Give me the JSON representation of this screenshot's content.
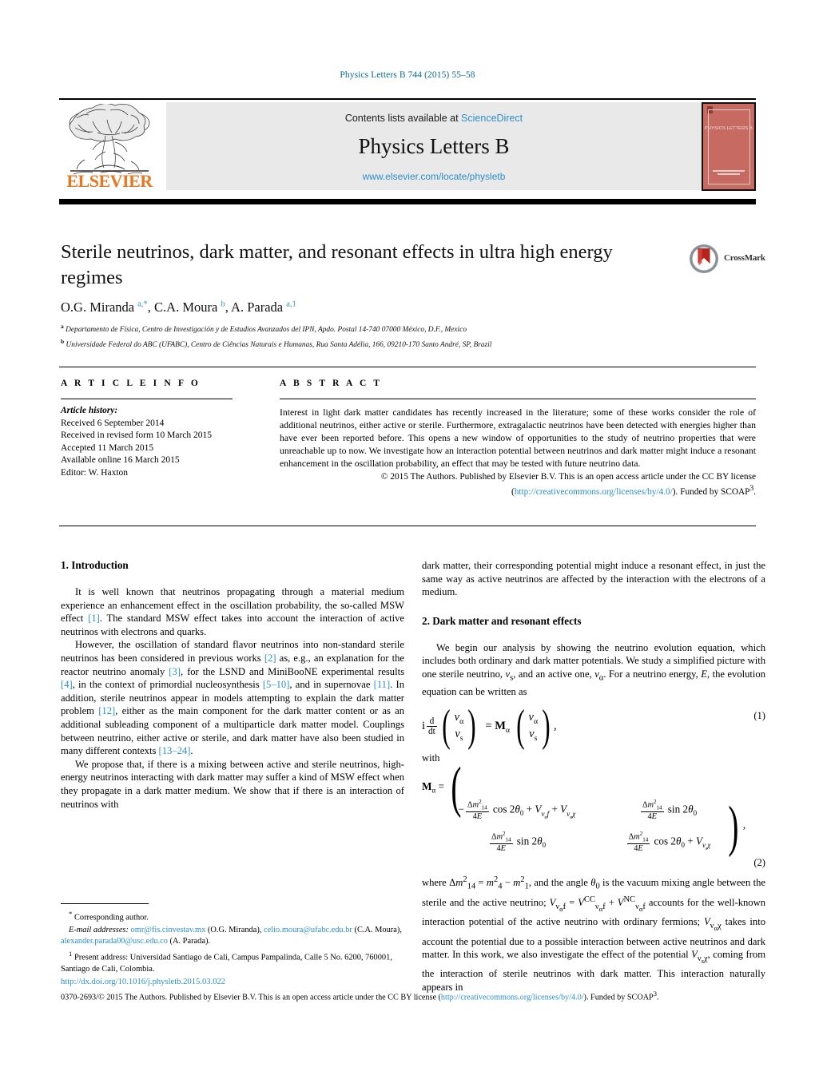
{
  "running_head": "Physics Letters B 744 (2015) 55–58",
  "masthead": {
    "contents_prefix": "Contents lists available at ",
    "sciencedirect": "ScienceDirect",
    "journal_name": "Physics Letters B",
    "journal_url": "www.elsevier.com/locate/physletb",
    "publisher_logo_text": "ELSEVIER",
    "cover_title": "PHYSICS LETTERS B"
  },
  "article": {
    "title": "Sterile neutrinos, dark matter, and resonant effects in ultra high energy regimes",
    "crossmark_label": "CrossMark",
    "authors_html": "O.G. Miranda <sup>a,*</sup>, C.A. Moura <sup>b</sup>, A. Parada <sup>a,1</sup>",
    "affiliation_a": "Departamento de Física, Centro de Investigación y de Estudios Avanzados del IPN, Apdo. Postal 14-740 07000 México, D.F., Mexico",
    "affiliation_b": "Universidade Federal do ABC (UFABC), Centro de Ciências Naturais e Humanas, Rua Santa Adélia, 166, 09210-170 Santo André, SP, Brazil"
  },
  "article_info": {
    "heading": "A R T I C L E   I N F O",
    "history_label": "Article history:",
    "received": "Received 6 September 2014",
    "revised": "Received in revised form 10 March 2015",
    "accepted": "Accepted 11 March 2015",
    "online": "Available online 16 March 2015",
    "editor": "Editor: W. Haxton"
  },
  "abstract": {
    "heading": "A B S T R A C T",
    "text": "Interest in light dark matter candidates has recently increased in the literature; some of these works consider the role of additional neutrinos, either active or sterile. Furthermore, extragalactic neutrinos have been detected with energies higher than have ever been reported before. This opens a new window of opportunities to the study of neutrino properties that were unreachable up to now. We investigate how an interaction potential between neutrinos and dark matter might induce a resonant enhancement in the oscillation probability, an effect that may be tested with future neutrino data.",
    "copyright_lead": "© 2015 The Authors. Published by Elsevier B.V. This is an open access article under the CC BY license",
    "license_open_paren": "(",
    "license_url": "http://creativecommons.org/licenses/by/4.0/",
    "copyright_tail": "). Funded by SCOAP",
    "scoap_sup": "3",
    "copyright_period": "."
  },
  "left_column": {
    "section_heading": "1. Introduction",
    "p1_a": "It is well known that neutrinos propagating through a material medium experience an enhancement effect in the oscillation probability, the so-called MSW effect ",
    "p1_ref1": "[1]",
    "p1_b": ". The standard MSW effect takes into account the interaction of active neutrinos with electrons and quarks.",
    "p2_a": "However, the oscillation of standard flavor neutrinos into non-standard sterile neutrinos has been considered in previous works ",
    "p2_ref2": "[2]",
    "p2_b": " as, e.g., an explanation for the reactor neutrino anomaly ",
    "p2_ref3": "[3]",
    "p2_c": ", for the LSND and MiniBooNE experimental results ",
    "p2_ref4": "[4]",
    "p2_d": ", in the context of primordial nucleosynthesis ",
    "p2_ref5": "[5–10]",
    "p2_e": ", and in supernovae ",
    "p2_ref11": "[11]",
    "p2_f": ". In addition, sterile neutrinos appear in models attempting to explain the dark matter problem ",
    "p2_ref12": "[12]",
    "p2_g": ", either as the main component for the dark matter content or as an additional subleading component of a multiparticle dark matter model. Couplings between neutrino, either active or sterile, and dark matter have also been studied in many different contexts ",
    "p2_ref13": "[13–24]",
    "p2_h": ".",
    "p3": "We propose that, if there is a mixing between active and sterile neutrinos, high-energy neutrinos interacting with dark matter may suffer a kind of MSW effect when they propagate in a dark matter medium. We show that if there is an interaction of neutrinos with"
  },
  "right_column": {
    "p1": "dark matter, their corresponding potential might induce a resonant effect, in just the same way as active neutrinos are affected by the interaction with the electrons of a medium.",
    "section_heading": "2. Dark matter and resonant effects",
    "p2_html": "We begin our analysis by showing the neutrino evolution equation, which includes both ordinary and dark matter potentials. We study a simplified picture with one sterile neutrino, <i>ν</i><sub>s</sub>, and an active one, <i>ν</i><sub>α</sub>. For a neutrino energy, <i>E</i>, the evolution equation can be written as",
    "eq1_number": "(1)",
    "with_label": "with",
    "eq2_number": "(2)",
    "p3_html": "where Δ<i>m</i><sup>2</sup><sub>14</sub> = <i>m</i><sup>2</sup><sub>4</sub> − <i>m</i><sup>2</sup><sub>1</sub>, and the angle <i>θ</i><sub>0</sub> is the vacuum mixing angle between the sterile and the active neutrino; <i>V</i><sub>ν<sub>α</sub>f</sub> = <i>V</i><sup>CC</sup><sub>ν<sub>α</sub>f</sub> + <i>V</i><sup>NC</sup><sub>ν<sub>α</sub>f</sub> accounts for the well-known interaction potential of the active neutrino with ordinary fermions; <i>V</i><sub>ν<sub>α</sub>χ</sub> takes into account the potential due to a possible interaction between active neutrinos and dark matter. In this work, we also investigate the effect of the potential <i>V</i><sub>ν<sub>s</sub>χ</sub>, coming from the interaction of sterile neutrinos with dark matter. This interaction naturally appears in"
  },
  "footnotes": {
    "corresponding_marker": "*",
    "corresponding": "Corresponding author.",
    "email_label": "E-mail addresses:",
    "email1": "omr@fis.cinvestav.mx",
    "email1_owner": "(O.G. Miranda),",
    "email2": "celio.moura@ufabc.edu.br",
    "email2_owner": "(C.A. Moura),",
    "email3": "alexander.parada00@usc.edu.co",
    "email3_owner": "(A. Parada).",
    "note1_marker": "1",
    "note1": "Present address: Universidad Santiago de Cali, Campus Pampalinda, Calle 5 No. 6200, 760001, Santiago de Cali, Colombia."
  },
  "footer": {
    "doi": "http://dx.doi.org/10.1016/j.physletb.2015.03.022",
    "issn_copy": "0370-2693/© 2015 The Authors. Published by Elsevier B.V. This is an open access article under the CC BY license (",
    "license_url": "http://creativecommons.org/licenses/by/4.0/",
    "copy_tail": "). Funded by SCOAP",
    "scoap_sup": "3",
    "copy_end": "."
  },
  "colors": {
    "link": "#2b8fce",
    "elsevier_orange": "#e87722",
    "cover_red": "#c76a62"
  }
}
